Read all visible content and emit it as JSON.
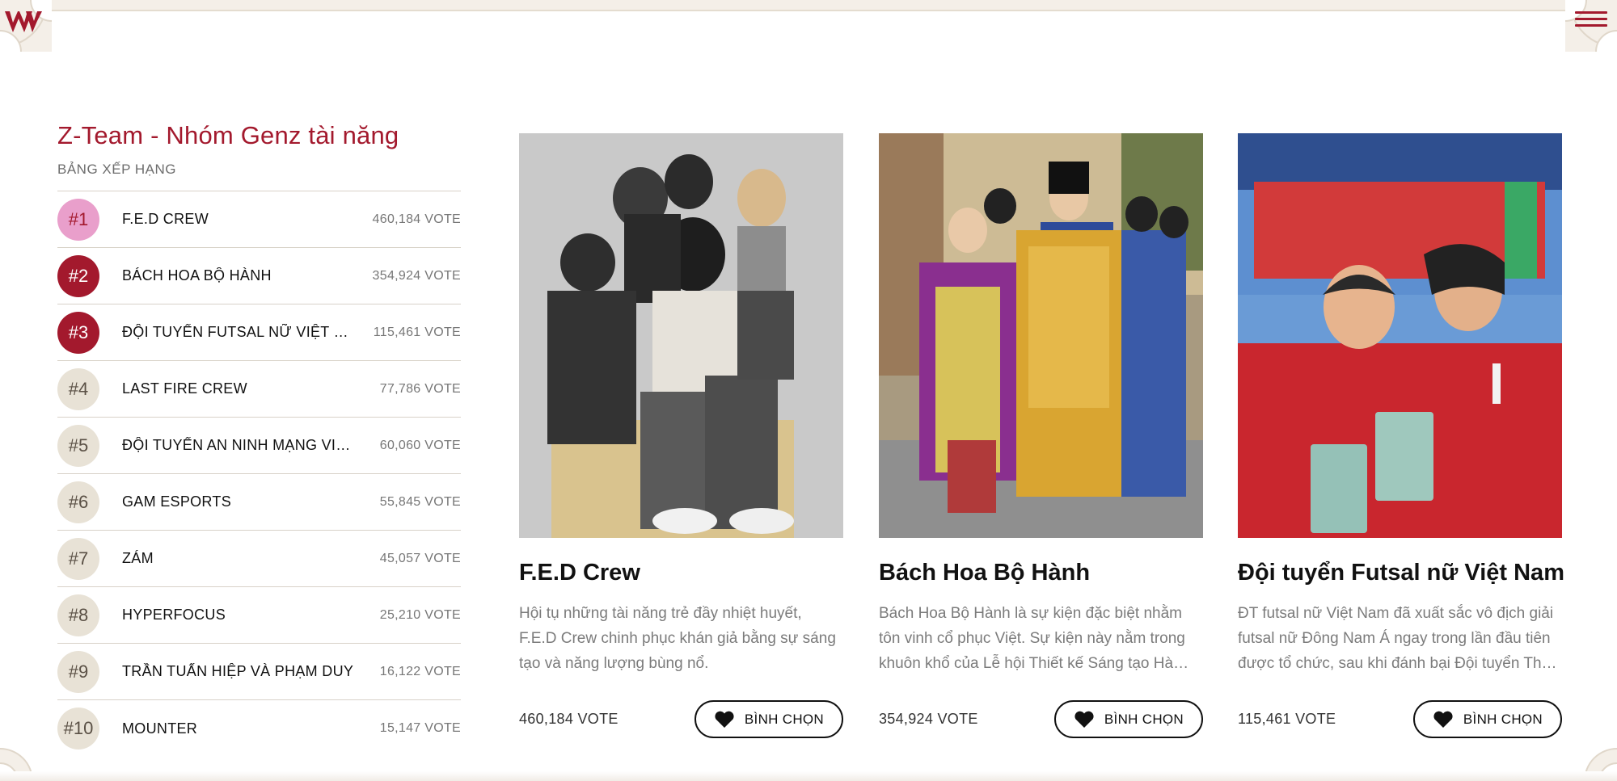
{
  "brand": {
    "logo_icon": "w-logo-icon",
    "accent": "#a3192d",
    "pink": "#e99fcb",
    "cream": "#e8e2d6"
  },
  "header": {
    "menu_icon": "hamburger-menu-icon"
  },
  "board": {
    "title": "Z-Team - Nhóm Genz tài năng",
    "subtitle": "BẢNG XẾP HẠNG",
    "rows": [
      {
        "rank": "#1",
        "name": "F.E.D CREW",
        "votes": "460,184 VOTE"
      },
      {
        "rank": "#2",
        "name": "BÁCH HOA BỘ HÀNH",
        "votes": "354,924 VOTE"
      },
      {
        "rank": "#3",
        "name": "ĐỘI TUYỂN FUTSAL NỮ VIỆT NAM",
        "votes": "115,461 VOTE"
      },
      {
        "rank": "#4",
        "name": "LAST FIRE CREW",
        "votes": "77,786 VOTE"
      },
      {
        "rank": "#5",
        "name": "ĐỘI TUYỂN AN NINH MẠNG VIETNAM",
        "votes": "60,060 VOTE"
      },
      {
        "rank": "#6",
        "name": "GAM ESPORTS",
        "votes": "55,845 VOTE"
      },
      {
        "rank": "#7",
        "name": "ZÁM",
        "votes": "45,057 VOTE"
      },
      {
        "rank": "#8",
        "name": "HYPERFOCUS",
        "votes": "25,210 VOTE"
      },
      {
        "rank": "#9",
        "name": "TRẦN TUẤN HIỆP VÀ PHẠM DUY",
        "votes": "16,122 VOTE"
      },
      {
        "rank": "#10",
        "name": "MOUNTER",
        "votes": "15,147 VOTE"
      }
    ]
  },
  "cards": [
    {
      "title": "F.E.D Crew",
      "desc": "Hội tụ những tài năng trẻ đầy nhiệt huyết, F.E.D Crew chinh phục khán giả bằng sự sáng tạo và năng lượng bùng nổ.",
      "votes": "460,184 VOTE",
      "button": "BÌNH CHỌN"
    },
    {
      "title": "Bách Hoa Bộ Hành",
      "desc": "Bách Hoa Bộ Hành là sự kiện đặc biệt nhằm tôn vinh cổ phục Việt. Sự kiện này nằm trong khuôn khổ của Lễ hội Thiết kế Sáng tạo Hà Nội.",
      "votes": "354,924 VOTE",
      "button": "BÌNH CHỌN"
    },
    {
      "title": "Đội tuyển Futsal nữ Việt Nam",
      "desc": "ĐT futsal nữ Việt Nam đã xuất sắc vô địch giải futsal nữ Đông Nam Á ngay trong lần đầu tiên được tổ chức, sau khi đánh bại Đội tuyển Thái Lan.",
      "votes": "115,461 VOTE",
      "button": "BÌNH CHỌN"
    }
  ]
}
